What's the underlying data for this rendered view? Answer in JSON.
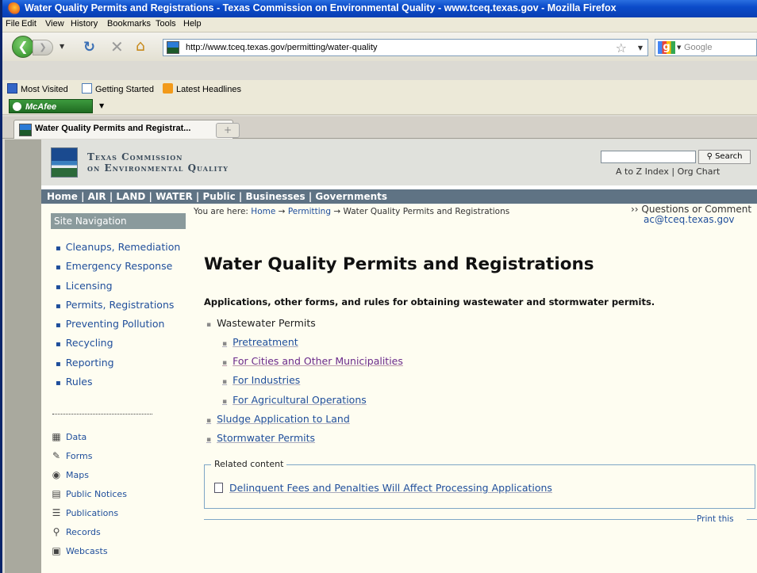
{
  "window": {
    "title": "Water Quality Permits and Registrations - Texas Commission on Environmental Quality - www.tceq.texas.gov - Mozilla Firefox"
  },
  "menu": [
    "File",
    "Edit",
    "View",
    "History",
    "Bookmarks",
    "Tools",
    "Help"
  ],
  "navbar": {
    "url": "http://www.tceq.texas.gov/permitting/water-quality",
    "search_placeholder": "Google"
  },
  "bookmarks": [
    "Most Visited",
    "Getting Started",
    "Latest Headlines"
  ],
  "mcafee": {
    "label": "McAfee"
  },
  "tab": {
    "label": "Water Quality Permits and Registrat..."
  },
  "header": {
    "agency_line1": "Texas Commission",
    "agency_line2": "on Environmental Quality",
    "search_button": "Search",
    "atoz": "A to Z Index",
    "sep": "|",
    "orgchart": "Org Chart"
  },
  "mainnav": {
    "text": "Home | AIR | LAND | WATER | Public | Businesses | Governments"
  },
  "sidebar": {
    "title": "Site Navigation",
    "items": [
      "Cleanups, Remediation",
      "Emergency Response",
      "Licensing",
      "Permits, Registrations",
      "Preventing Pollution",
      "Recycling",
      "Reporting",
      "Rules"
    ],
    "tools": [
      {
        "label": "Data",
        "icon": "chart-icon"
      },
      {
        "label": "Forms",
        "icon": "pencil-icon"
      },
      {
        "label": "Maps",
        "icon": "globe-icon"
      },
      {
        "label": "Public Notices",
        "icon": "notice-icon"
      },
      {
        "label": "Publications",
        "icon": "books-icon"
      },
      {
        "label": "Records",
        "icon": "magnifier-icon"
      },
      {
        "label": "Webcasts",
        "icon": "monitor-icon"
      }
    ]
  },
  "breadcrumb": {
    "prefix": "You are here:",
    "home": "Home",
    "arrow": "→",
    "permitting": "Permitting",
    "current": "Water Quality Permits and Registrations"
  },
  "questions": {
    "label": "›› Questions or Comment",
    "email": "ac@tceq.texas.gov"
  },
  "main": {
    "title": "Water Quality Permits and Registrations",
    "intro": "Applications, other forms, and rules for obtaining wastewater and stormwater permits.",
    "wastewater": "Wastewater Permits",
    "pretreatment": "Pretreatment",
    "cities": "For Cities and Other Municipalities",
    "industries": "For Industries",
    "agricultural": "For Agricultural Operations",
    "sludge": "Sludge Application to Land",
    "stormwater": "Stormwater Permits",
    "related_title": "Related content",
    "related_link": "Delinquent Fees and Penalties Will Affect Processing Applications",
    "print": "Print this"
  }
}
